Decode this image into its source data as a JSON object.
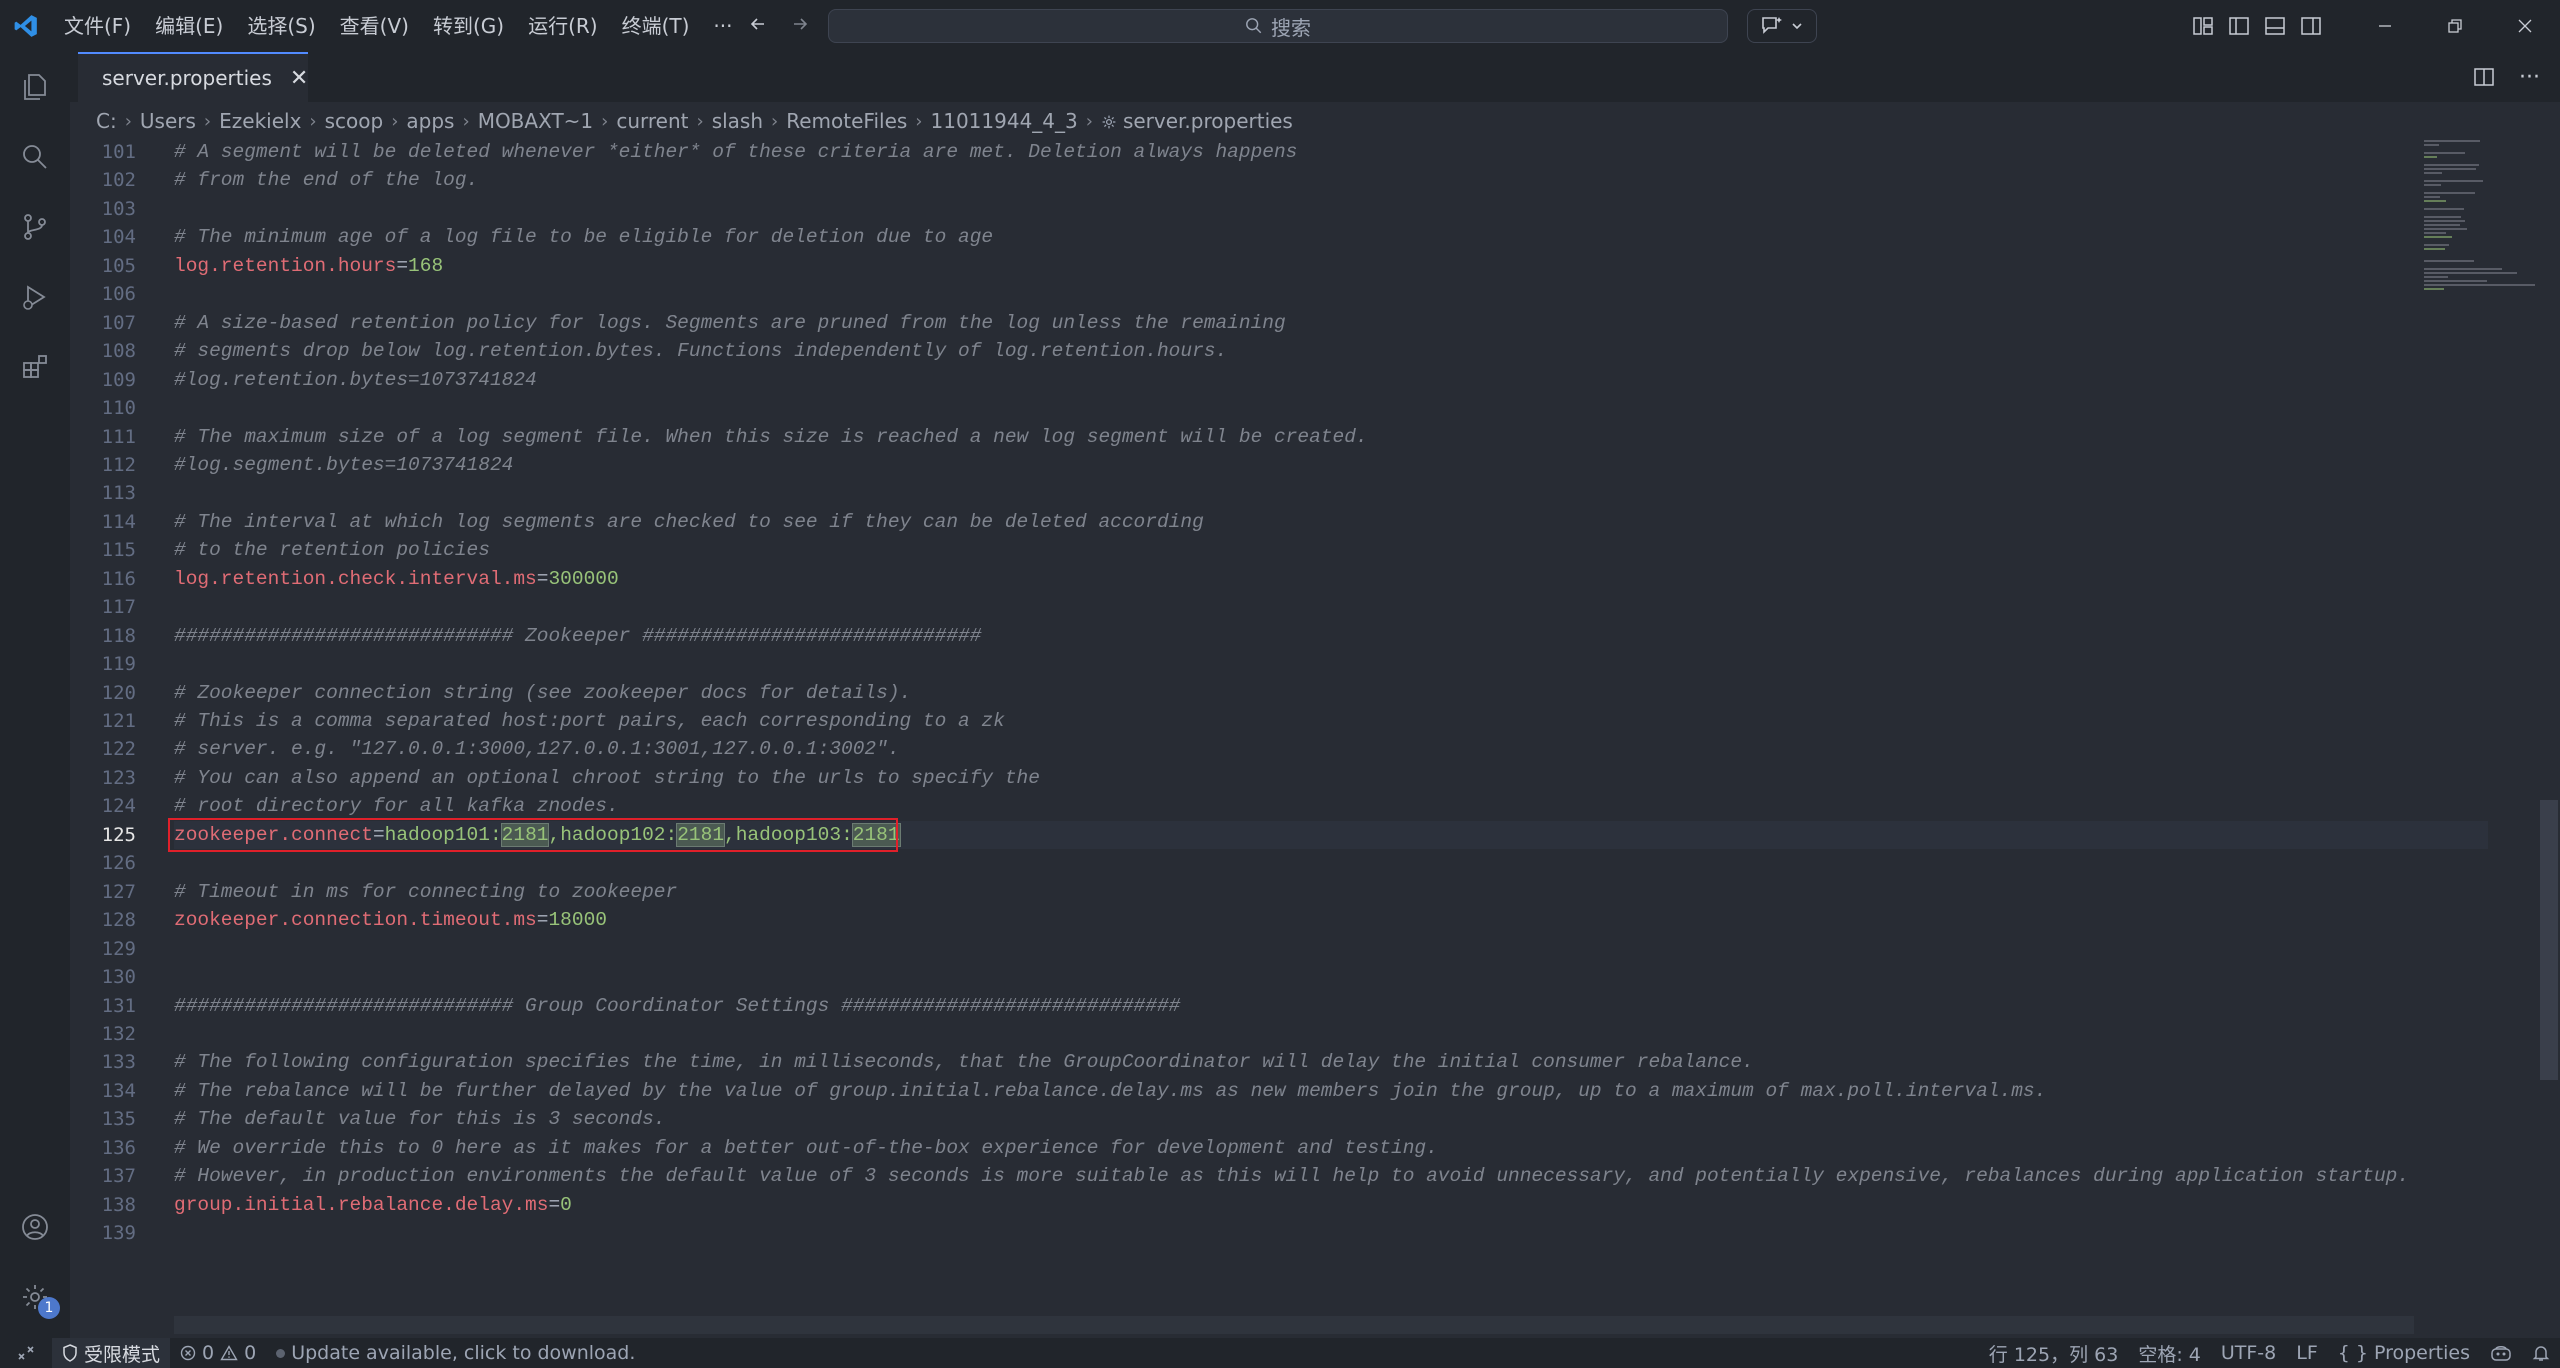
{
  "menu": [
    "文件(F)",
    "编辑(E)",
    "选择(S)",
    "查看(V)",
    "转到(G)",
    "运行(R)",
    "终端(T)"
  ],
  "menu_more": "···",
  "search": {
    "label": "搜索"
  },
  "tab": {
    "title": "server.properties",
    "close": "✕"
  },
  "breadcrumb": [
    "C:",
    "Users",
    "Ezekielx",
    "scoop",
    "apps",
    "MOBAXT~1",
    "current",
    "slash",
    "RemoteFiles",
    "11011944_4_3",
    "server.properties"
  ],
  "editor": {
    "active_line": 125,
    "lines": [
      {
        "n": "101",
        "t": "comment",
        "text": "# A segment will be deleted whenever *either* of these criteria are met. Deletion always happens"
      },
      {
        "n": "102",
        "t": "comment",
        "text": "# from the end of the log."
      },
      {
        "n": "103",
        "t": "blank",
        "text": ""
      },
      {
        "n": "104",
        "t": "comment",
        "text": "# The minimum age of a log file to be eligible for deletion due to age"
      },
      {
        "n": "105",
        "t": "kv",
        "key": "log.retention.hours",
        "val": "168"
      },
      {
        "n": "106",
        "t": "blank",
        "text": ""
      },
      {
        "n": "107",
        "t": "comment",
        "text": "# A size-based retention policy for logs. Segments are pruned from the log unless the remaining"
      },
      {
        "n": "108",
        "t": "comment",
        "text": "# segments drop below log.retention.bytes. Functions independently of log.retention.hours."
      },
      {
        "n": "109",
        "t": "comment",
        "text": "#log.retention.bytes=1073741824"
      },
      {
        "n": "110",
        "t": "blank",
        "text": ""
      },
      {
        "n": "111",
        "t": "comment",
        "text": "# The maximum size of a log segment file. When this size is reached a new log segment will be created."
      },
      {
        "n": "112",
        "t": "comment",
        "text": "#log.segment.bytes=1073741824"
      },
      {
        "n": "113",
        "t": "blank",
        "text": ""
      },
      {
        "n": "114",
        "t": "comment",
        "text": "# The interval at which log segments are checked to see if they can be deleted according"
      },
      {
        "n": "115",
        "t": "comment",
        "text": "# to the retention policies"
      },
      {
        "n": "116",
        "t": "kv",
        "key": "log.retention.check.interval.ms",
        "val": "300000"
      },
      {
        "n": "117",
        "t": "blank",
        "text": ""
      },
      {
        "n": "118",
        "t": "comment",
        "text": "############################# Zookeeper #############################"
      },
      {
        "n": "119",
        "t": "blank",
        "text": ""
      },
      {
        "n": "120",
        "t": "comment",
        "text": "# Zookeeper connection string (see zookeeper docs for details)."
      },
      {
        "n": "121",
        "t": "comment",
        "text": "# This is a comma separated host:port pairs, each corresponding to a zk"
      },
      {
        "n": "122",
        "t": "comment",
        "text": "# server. e.g. \"127.0.0.1:3000,127.0.0.1:3001,127.0.0.1:3002\"."
      },
      {
        "n": "123",
        "t": "comment",
        "text": "# You can also append an optional chroot string to the urls to specify the"
      },
      {
        "n": "124",
        "t": "comment",
        "text": "# root directory for all kafka znodes."
      },
      {
        "n": "125",
        "t": "zk",
        "key": "zookeeper.connect",
        "hosts": [
          {
            "host": "hadoop101",
            "port": "2181"
          },
          {
            "host": "hadoop102",
            "port": "2181"
          },
          {
            "host": "hadoop103",
            "port": "2181"
          }
        ]
      },
      {
        "n": "126",
        "t": "blank",
        "text": ""
      },
      {
        "n": "127",
        "t": "comment",
        "text": "# Timeout in ms for connecting to zookeeper"
      },
      {
        "n": "128",
        "t": "kv",
        "key": "zookeeper.connection.timeout.ms",
        "val": "18000"
      },
      {
        "n": "129",
        "t": "blank",
        "text": ""
      },
      {
        "n": "130",
        "t": "blank",
        "text": ""
      },
      {
        "n": "131",
        "t": "comment",
        "text": "############################# Group Coordinator Settings #############################"
      },
      {
        "n": "132",
        "t": "blank",
        "text": ""
      },
      {
        "n": "133",
        "t": "comment",
        "text": "# The following configuration specifies the time, in milliseconds, that the GroupCoordinator will delay the initial consumer rebalance."
      },
      {
        "n": "134",
        "t": "comment",
        "text": "# The rebalance will be further delayed by the value of group.initial.rebalance.delay.ms as new members join the group, up to a maximum of max.poll.interval.ms."
      },
      {
        "n": "135",
        "t": "comment",
        "text": "# The default value for this is 3 seconds."
      },
      {
        "n": "136",
        "t": "comment",
        "text": "# We override this to 0 here as it makes for a better out-of-the-box experience for development and testing."
      },
      {
        "n": "137",
        "t": "comment",
        "text": "# However, in production environments the default value of 3 seconds is more suitable as this will help to avoid unnecessary, and potentially expensive, rebalances during application startup."
      },
      {
        "n": "138",
        "t": "kv",
        "key": "group.initial.rebalance.delay.ms",
        "val": "0"
      },
      {
        "n": "139",
        "t": "blank",
        "text": ""
      }
    ]
  },
  "status": {
    "restricted_mode": "受限模式",
    "errors": "0",
    "warnings": "0",
    "update_message": "Update available, click to download.",
    "cursor": "行 125，列 63",
    "indent": "空格: 4",
    "encoding": "UTF-8",
    "eol": "LF",
    "language": "Properties",
    "accounts_badge": "1"
  },
  "colors": {
    "accent": "#528bff",
    "highlight_box": "#e0202a",
    "key": "#e06c75",
    "value": "#98c379",
    "comment": "#7f848e"
  }
}
